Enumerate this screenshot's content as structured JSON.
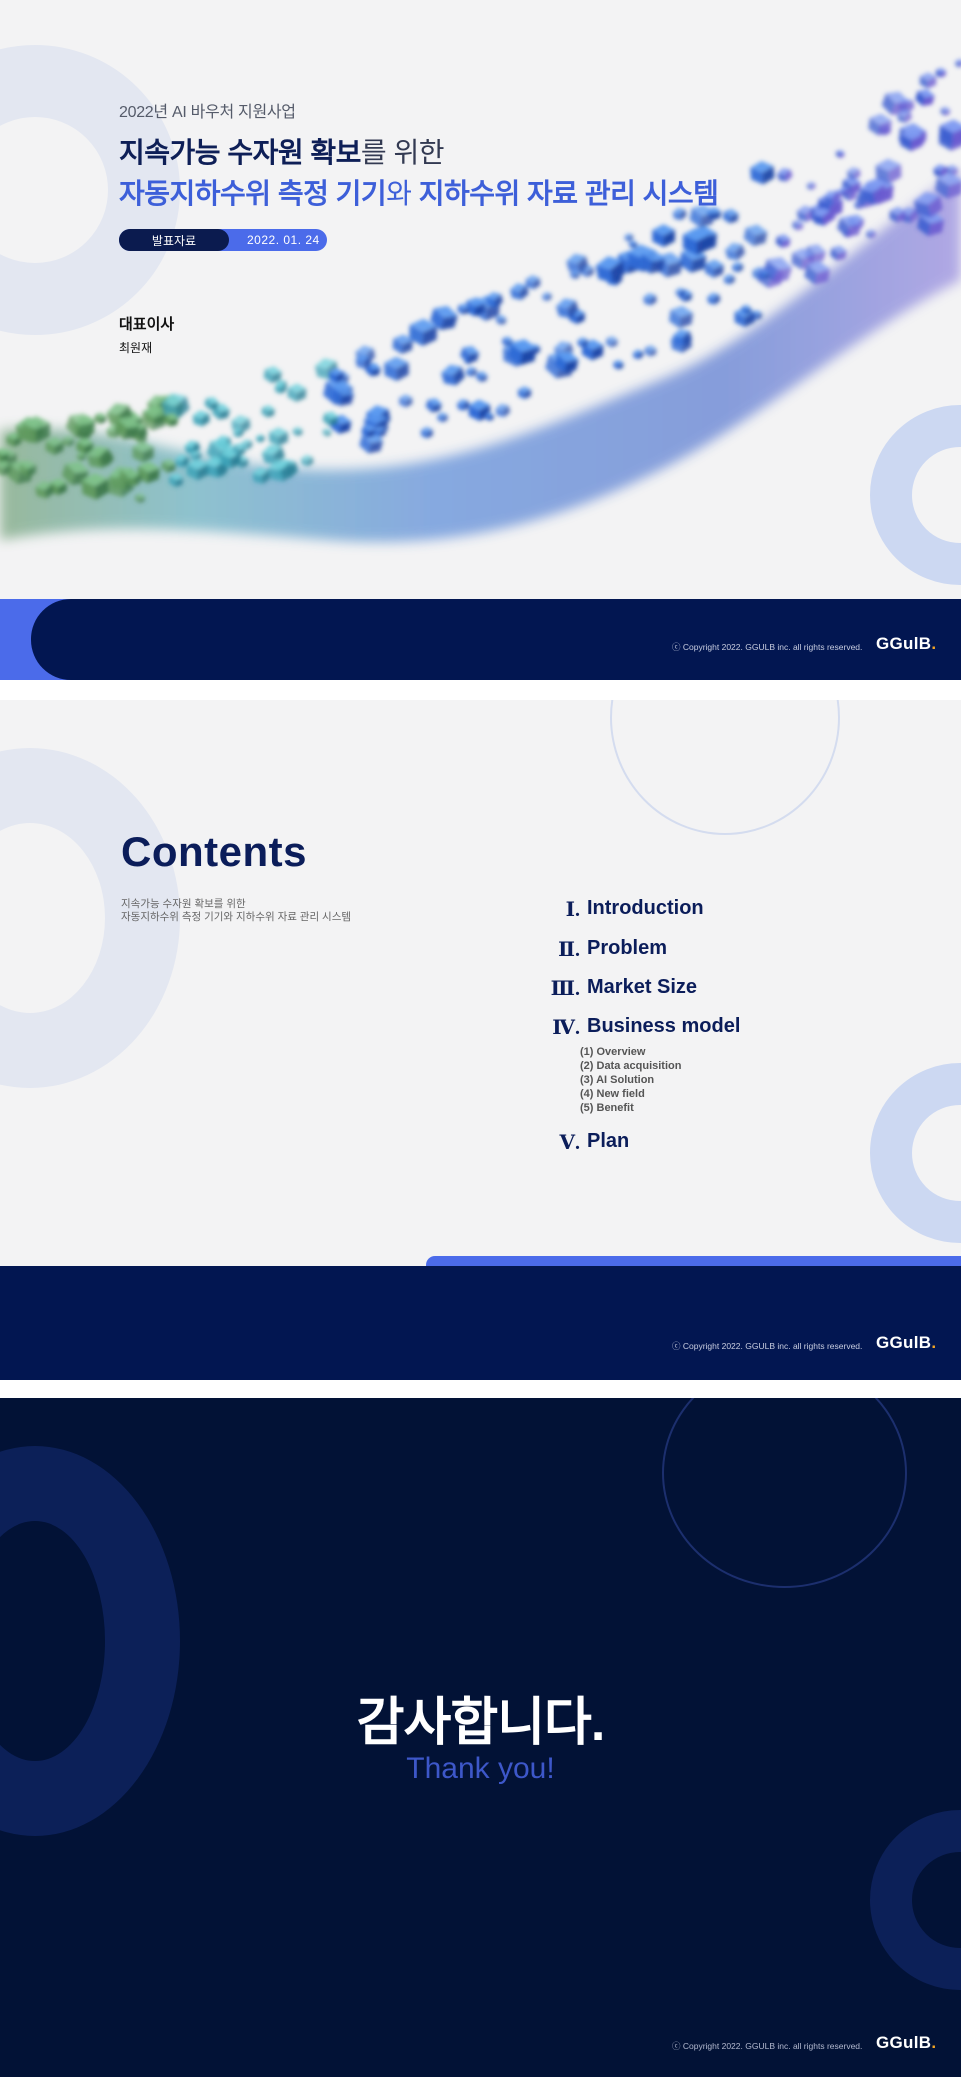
{
  "slide1": {
    "program": "2022년 AI 바우처 지원사업",
    "title_line1_bold": "지속가능 수자원 확보",
    "title_line1_thin": "를 위한",
    "title_line2_bold_a": "자동지하수위 측정 기기",
    "title_line2_thin": "와",
    "title_line2_bold_b": "지하수위 자료 관리 시스템",
    "tag_label": "발표자료",
    "tag_date": "2022. 01. 24",
    "presenter_role": "대표이사",
    "presenter_name": "최원재",
    "copyright": "ⓒ Copyright 2022. GGULB inc. all rights reserved.",
    "logo_text": "GGulB",
    "logo_dot": "."
  },
  "slide2": {
    "title": "Contents",
    "subtitle_line1": "지속가능 수자원 확보를 위한",
    "subtitle_line2": "자동지하수위 측정 기기와 지하수위 자료 관리 시스템",
    "items": [
      {
        "num": "Ⅰ.",
        "label": "Introduction"
      },
      {
        "num": "Ⅱ.",
        "label": "Problem"
      },
      {
        "num": "Ⅲ.",
        "label": "Market Size"
      },
      {
        "num": "Ⅳ.",
        "label": "Business model"
      },
      {
        "num": "Ⅴ.",
        "label": "Plan"
      }
    ],
    "sub_items": [
      "(1) Overview",
      "(2) Data acquisition",
      "(3) AI Solution",
      "(4) New field",
      "(5) Benefit"
    ],
    "copyright": "ⓒ Copyright 2022. GGULB inc. all rights reserved.",
    "logo_text": "GGulB",
    "logo_dot": "."
  },
  "slide3": {
    "thanks_ko": "감사합니다.",
    "thanks_en": "Thank you!",
    "copyright": "ⓒ Copyright 2022. GGULB inc. all rights reserved.",
    "logo_text": "GGulB",
    "logo_dot": "."
  },
  "colors": {
    "navy": "#021651",
    "accent_blue": "#4b6bea",
    "title_blue": "#3d5fd9",
    "dark_bg": "#021236"
  }
}
